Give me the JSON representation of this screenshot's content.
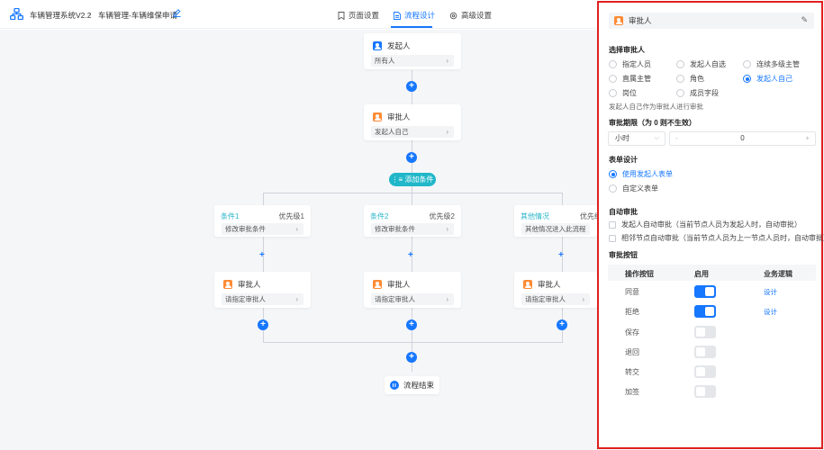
{
  "app": {
    "name": "车辆管理系统V2.2",
    "breadcrumb_current": "车辆管理-车辆维保申请"
  },
  "tabs": [
    {
      "label": "页面设置",
      "icon": "bookmark-icon",
      "active": false
    },
    {
      "label": "流程设计",
      "icon": "document-icon",
      "active": true
    },
    {
      "label": "高级设置",
      "icon": "gear-icon",
      "active": false
    }
  ],
  "flow": {
    "start": {
      "title": "发起人",
      "body": "所有人"
    },
    "approver": {
      "title": "审批人",
      "body": "发起人自己"
    },
    "add_condition": "添加条件",
    "branches": [
      {
        "cond_title": "条件1",
        "priority": "优先级1",
        "cond_body": "修改审批条件",
        "approver_title": "审批人",
        "approver_body": "请指定审批人"
      },
      {
        "cond_title": "条件2",
        "priority": "优先级2",
        "cond_body": "修改审批条件",
        "approver_title": "审批人",
        "approver_body": "请指定审批人"
      },
      {
        "cond_title": "其他情况",
        "priority": "优先级",
        "cond_body": "其他情况进入此流程",
        "approver_title": "审批人",
        "approver_body": "请指定审批人"
      }
    ],
    "end": "流程结束"
  },
  "panel": {
    "title": "审批人",
    "approver_section": "选择审批人",
    "approver_options": [
      {
        "label": "指定人员",
        "selected": false
      },
      {
        "label": "发起人自选",
        "selected": false
      },
      {
        "label": "连续多级主管",
        "selected": false
      },
      {
        "label": "直属主管",
        "selected": false
      },
      {
        "label": "角色",
        "selected": false
      },
      {
        "label": "发起人自己",
        "selected": true
      },
      {
        "label": "岗位",
        "selected": false
      },
      {
        "label": "成员字段",
        "selected": false
      }
    ],
    "approver_hint": "发起人自己作为审批人进行审批",
    "deadline_section": "审批期限（为 0 则不生效）",
    "deadline_unit": "小时",
    "deadline_value": "0",
    "form_section": "表单设计",
    "form_options": [
      {
        "label": "使用发起人表单",
        "selected": true
      },
      {
        "label": "自定义表单",
        "selected": false
      }
    ],
    "auto_section": "自动审批",
    "auto_options": [
      "发起人自动审批（当前节点人员为发起人时，自动审批）",
      "相邻节点自动审批（当前节点人员为上一节点人员时，自动审批）"
    ],
    "buttons_section": "审批按钮",
    "table_headers": {
      "op": "操作按钮",
      "enable": "启用",
      "logic": "业务逻辑"
    },
    "table_rows": [
      {
        "op": "同意",
        "enabled": true,
        "logic": "设计"
      },
      {
        "op": "拒绝",
        "enabled": true,
        "logic": "设计"
      },
      {
        "op": "保存",
        "enabled": false,
        "logic": ""
      },
      {
        "op": "退回",
        "enabled": false,
        "logic": ""
      },
      {
        "op": "转交",
        "enabled": false,
        "logic": ""
      },
      {
        "op": "加签",
        "enabled": false,
        "logic": ""
      }
    ]
  },
  "colors": {
    "accent": "#1677ff",
    "condition": "#20b7c9",
    "approver_icon": "#ff8a34",
    "highlight_border": "#e02020"
  }
}
